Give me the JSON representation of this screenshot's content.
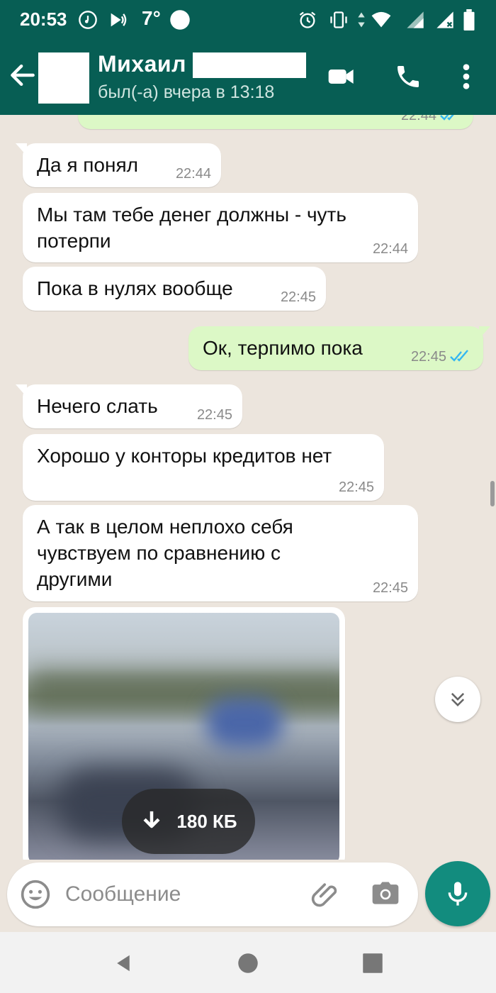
{
  "status_bar": {
    "time": "20:53",
    "temperature": "7°",
    "icons": [
      "music-note-icon",
      "cast-icon",
      "circle-icon",
      "alarm-icon",
      "vibrate-icon",
      "data-arrows-icon",
      "wifi-icon",
      "signal-icon",
      "signal-x-icon",
      "battery-icon"
    ]
  },
  "header": {
    "contact_name": "Михаил",
    "last_seen": "был(-а) вчера в 13:18",
    "icons": [
      "back-arrow-icon",
      "video-call-icon",
      "phone-icon",
      "more-vert-icon"
    ]
  },
  "messages": [
    {
      "direction": "out",
      "text": "",
      "time": "22:44",
      "read": true
    },
    {
      "direction": "in",
      "text": "Да я понял",
      "time": "22:44"
    },
    {
      "direction": "in",
      "text": "Мы там тебе денег должны - чуть потерпи",
      "time": "22:44"
    },
    {
      "direction": "in",
      "text": "Пока в нулях вообще",
      "time": "22:45"
    },
    {
      "direction": "out",
      "text": "Ок, терпимо пока",
      "time": "22:45",
      "read": true
    },
    {
      "direction": "in",
      "text": "Нечего слать",
      "time": "22:45"
    },
    {
      "direction": "in",
      "text": "Хорошо у конторы кредитов нет",
      "time": "22:45"
    },
    {
      "direction": "in",
      "text": "А так в целом неплохо себя чувствуем по сравнению с другими",
      "time": "22:45"
    },
    {
      "direction": "in",
      "type": "image",
      "download_size": "180 КБ"
    }
  ],
  "composer": {
    "placeholder": "Сообщение",
    "icons": [
      "emoji-icon",
      "attach-icon",
      "camera-icon",
      "mic-icon"
    ]
  },
  "colors": {
    "header": "#075e54",
    "outgoing_bubble": "#dcf8c6",
    "incoming_bubble": "#ffffff",
    "chat_background": "#ece5dd",
    "accent": "#128c7e",
    "read_ticks": "#34b7f1"
  }
}
